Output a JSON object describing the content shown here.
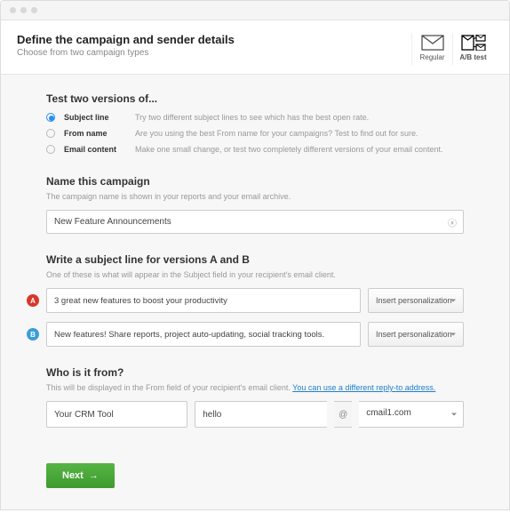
{
  "header": {
    "title": "Define the campaign and sender details",
    "subtitle": "Choose from two campaign types",
    "tabs": {
      "regular": "Regular",
      "abtest": "A/B test"
    }
  },
  "testVersions": {
    "title": "Test two versions of...",
    "options": [
      {
        "label": "Subject line",
        "desc": "Try two different subject lines to see which has the best open rate."
      },
      {
        "label": "From name",
        "desc": "Are you using the best From name for your campaigns? Test to find out for sure."
      },
      {
        "label": "Email content",
        "desc": "Make one small change, or test two completely different versions of your email content."
      }
    ]
  },
  "nameCampaign": {
    "title": "Name this campaign",
    "sub": "The campaign name is shown in your reports and your email archive.",
    "value": "New Feature Announcements"
  },
  "subject": {
    "title": "Write a subject line for versions A and B",
    "sub": "One of these is what will appear in the Subject field in your recipient's email client.",
    "a": {
      "badge": "A",
      "value": "3 great new features to boost your productivity",
      "insert": "Insert personalization"
    },
    "b": {
      "badge": "B",
      "value": "New features! Share reports, project auto-updating, social tracking tools.",
      "insert": "Insert personalization"
    }
  },
  "from": {
    "title": "Who is it from?",
    "subPrefix": "This will be displayed in the From field of your recipient's email client. ",
    "subLink": "You can use a different reply-to address.",
    "name": "Your CRM Tool",
    "emailLocal": "hello",
    "at": "@",
    "domain": "cmail1.com"
  },
  "nextButton": "Next"
}
